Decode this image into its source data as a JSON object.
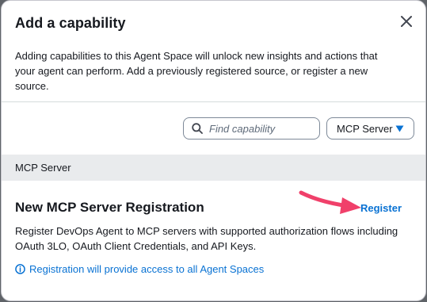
{
  "modal": {
    "title": "Add a capability",
    "description": "Adding capabilities to this Agent Space will unlock new insights and actions that your agent can perform. Add a previously registered source, or register a new source."
  },
  "filter": {
    "search_placeholder": "Find capability",
    "selected_option": "MCP Server"
  },
  "group": {
    "label": "MCP Server"
  },
  "item": {
    "title": "New MCP Server Registration",
    "action_label": "Register",
    "description": "Register DevOps Agent to MCP servers with supported authorization flows including OAuth 3LO, OAuth Client Credentials, and API Keys.",
    "info_text": "Registration will provide access to all Agent Spaces"
  },
  "icons": {
    "close": "close-icon",
    "search": "search-icon",
    "caret": "caret-down-icon",
    "info": "info-icon",
    "annotation": "arrow-annotation"
  },
  "colors": {
    "link": "#0972d3",
    "annotation_arrow": "#f0406a",
    "group_header_bg": "#e9ebed"
  }
}
